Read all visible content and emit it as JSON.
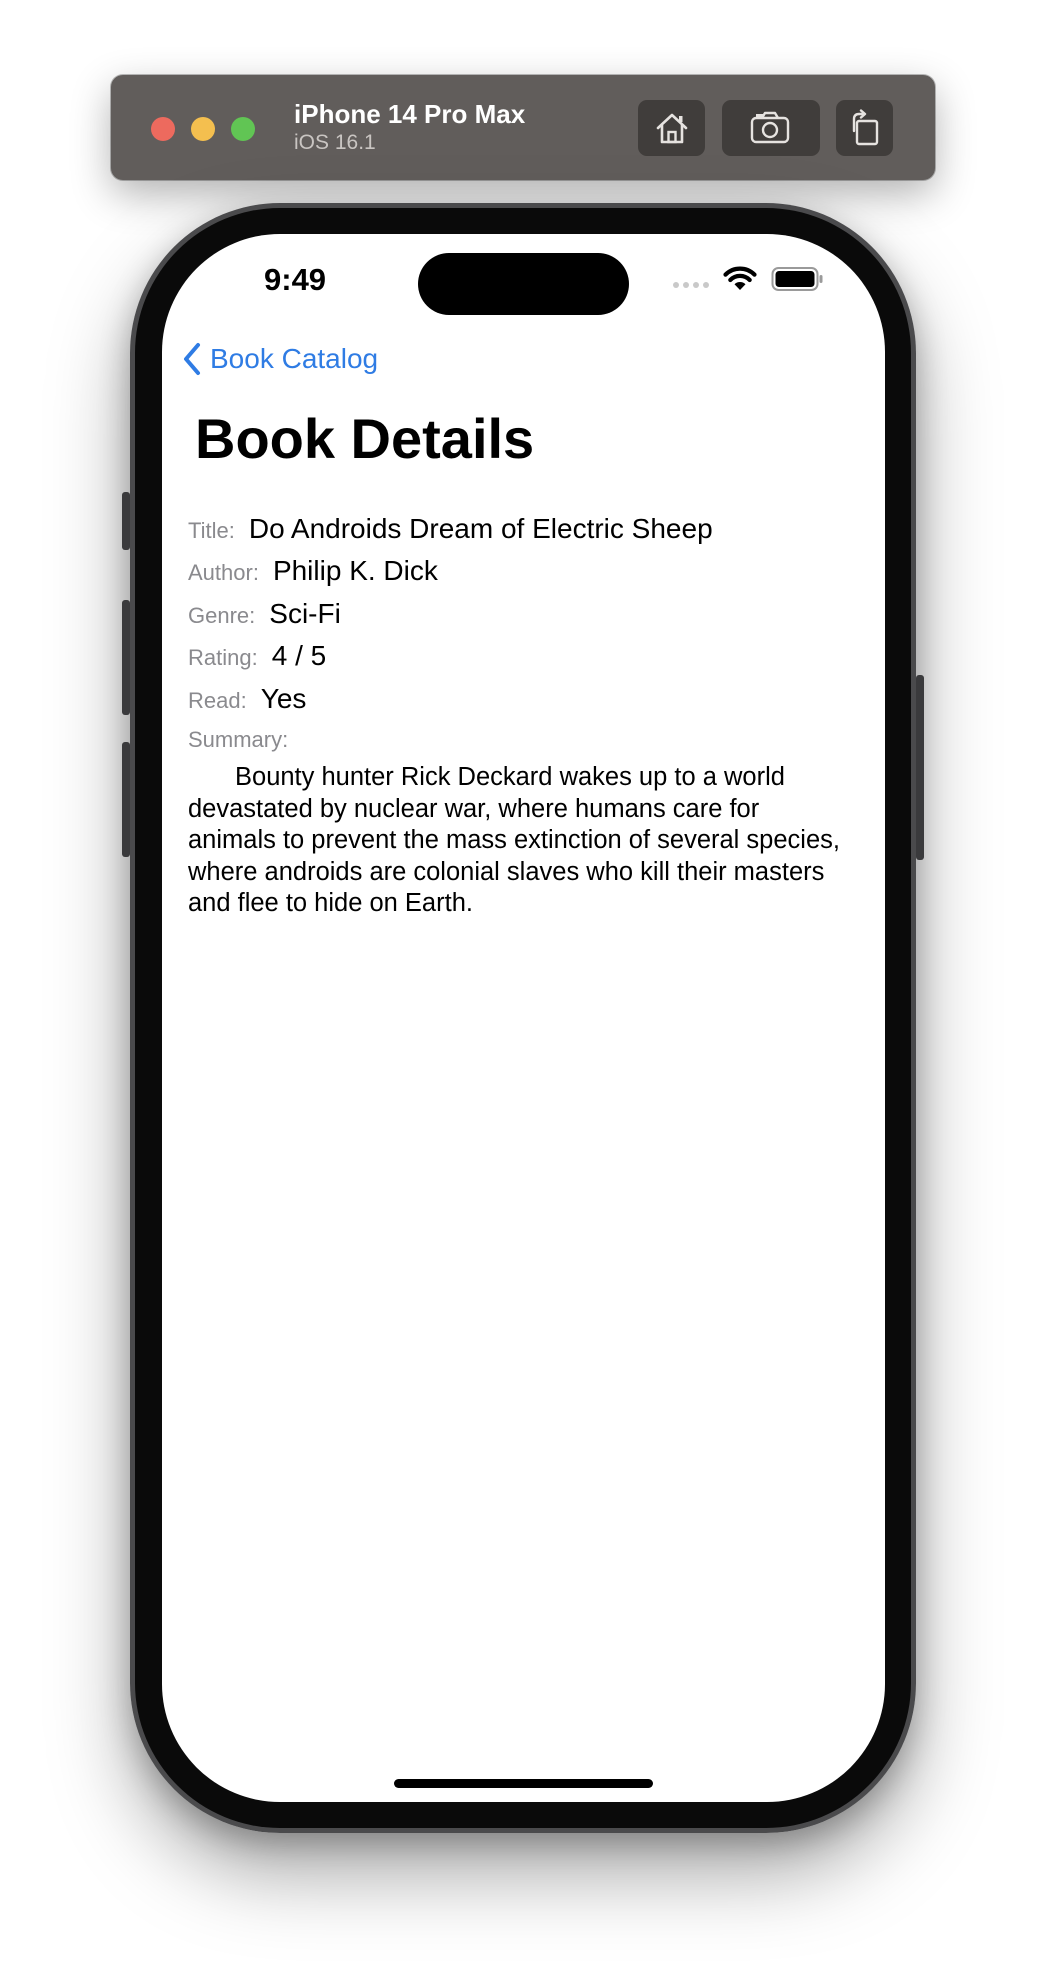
{
  "simulator": {
    "device_name": "iPhone 14 Pro Max",
    "os_version": "iOS 16.1",
    "buttons": {
      "home_icon": "home-icon",
      "screenshot_icon": "camera-icon",
      "rotate_icon": "rotate-icon"
    }
  },
  "status_bar": {
    "time": "9:49",
    "icons": [
      "cellular-dots-icon",
      "wifi-icon",
      "battery-icon"
    ]
  },
  "navigation": {
    "back_label": "Book Catalog",
    "title": "Book Details"
  },
  "book": {
    "title_label": "Title:",
    "title_value": "Do Androids Dream of Electric Sheep",
    "author_label": "Author:",
    "author_value": "Philip K. Dick",
    "genre_label": "Genre:",
    "genre_value": "Sci-Fi",
    "rating_label": "Rating:",
    "rating_value": "4 / 5",
    "read_label": "Read:",
    "read_value": "Yes",
    "summary_label": "Summary:",
    "summary_text": "Bounty hunter Rick Deckard wakes up to a world devastated by nuclear war, where humans care for animals to prevent the mass extinction of several species, where androids are colonial slaves who kill their masters and flee to hide on Earth."
  },
  "colors": {
    "accent": "#2f7ce4",
    "label_gray": "#8a8a8e",
    "toolbar_bg": "#615d5b"
  }
}
